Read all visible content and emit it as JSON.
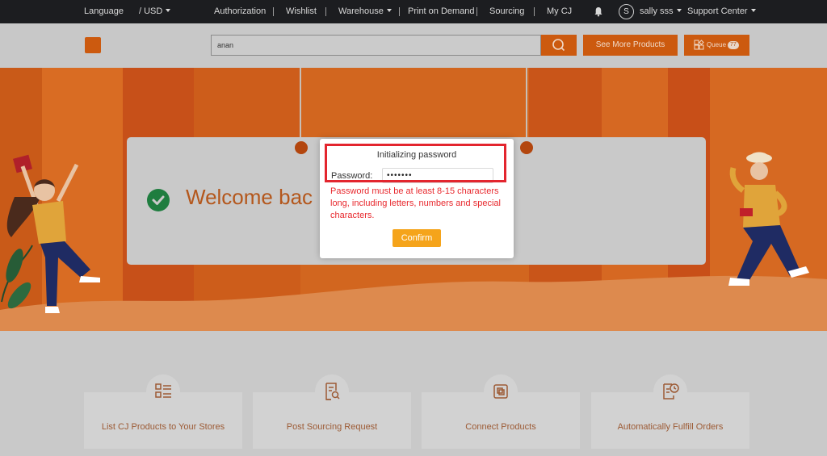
{
  "topbar": {
    "language": "Language",
    "currency": "/ USD",
    "authorization": "Authorization",
    "wishlist": "Wishlist",
    "warehouse": "Warehouse",
    "print_on_demand": "Print on Demand",
    "sourcing": "Sourcing",
    "my_cj": "My CJ",
    "avatar_initial": "S",
    "username": "sally sss",
    "support_center": "Support Center"
  },
  "header": {
    "search_value": "anan",
    "see_more_label": "See More Products",
    "queue_label": "Queue",
    "queue_count": "77"
  },
  "banner": {
    "welcome_text": "Welcome bac                                                ng, now you can:"
  },
  "modal": {
    "title": "Initializing password",
    "password_label": "Password:",
    "password_value": "•••••••",
    "error_text": "Password must be at least 8-15 characters long, including letters, numbers and special characters.",
    "confirm_label": "Confirm"
  },
  "features": [
    {
      "label": "List CJ Products to Your Stores",
      "icon": "list-icon"
    },
    {
      "label": "Post Sourcing Request",
      "icon": "document-search-icon"
    },
    {
      "label": "Connect Products",
      "icon": "connect-icon"
    },
    {
      "label": "Automatically Fulfill Orders",
      "icon": "clock-order-icon"
    }
  ],
  "colors": {
    "accent": "#cc5a0f",
    "error": "#e8282d",
    "confirm": "#f5a41b",
    "success": "#1f7d3f"
  }
}
